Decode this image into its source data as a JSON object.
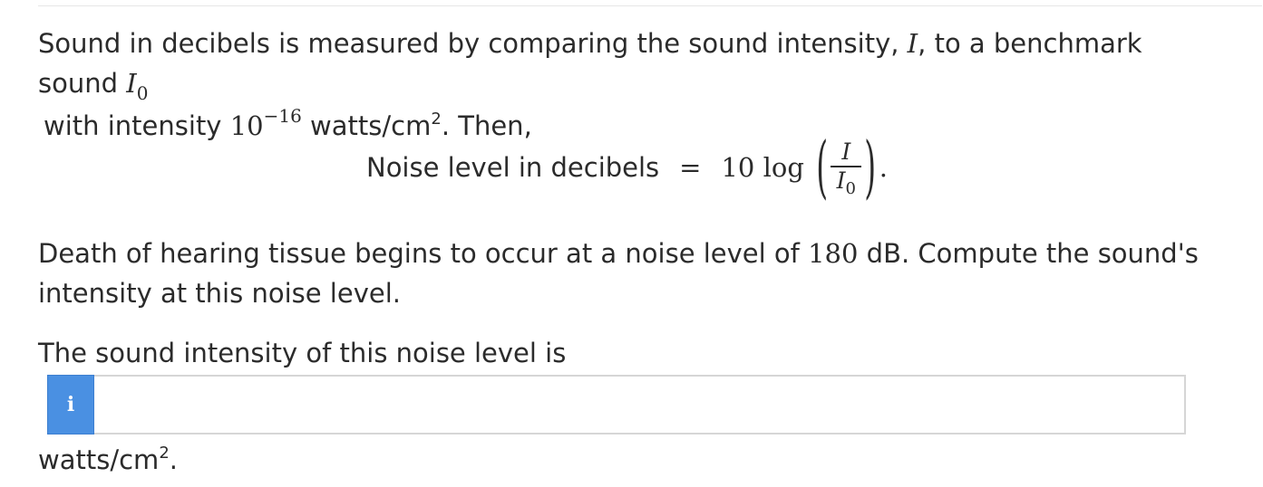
{
  "question": {
    "intro": {
      "part1": "Sound in decibels is measured by comparing the sound intensity, ",
      "var_I": "I",
      "part2": ", to a benchmark sound ",
      "var_I0": "I",
      "sub_0": "0",
      "line2_part1": "with intensity ",
      "base": "10",
      "exponent": "−16",
      "unit": " watts/cm",
      "unit_sup": "2",
      "tail": ". Then,"
    },
    "equation": {
      "label": "Noise level in decibels",
      "equals": "=",
      "coefficient": "10 log",
      "numerator": "I",
      "denominator": "I",
      "denominator_sub": "0",
      "end": "."
    },
    "problem": {
      "part1": "Death of hearing tissue begins to occur at a noise level of ",
      "value": "180",
      "part2": " dB. Compute the sound's intensity at this noise level."
    },
    "prompt": "The sound intensity of this noise level is"
  },
  "answer": {
    "info_icon": "i",
    "input_value": "",
    "input_placeholder": ""
  },
  "units": {
    "label": "watts/cm",
    "sup": "2",
    "end": "."
  },
  "colors": {
    "text": "#2b2b2b",
    "info_button": "#4a90e2",
    "input_border": "#d6d6d6"
  }
}
